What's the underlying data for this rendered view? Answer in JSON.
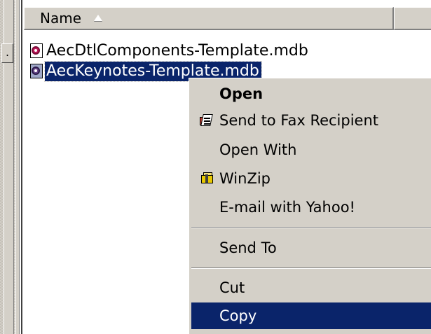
{
  "file_list": {
    "column_header": "Name",
    "files": [
      {
        "name": "AecDtlComponents-Template.mdb",
        "selected": false
      },
      {
        "name": "AecKeynotes-Template.mdb",
        "selected": true
      }
    ]
  },
  "context_menu": {
    "items": [
      {
        "label": "Open",
        "bold": true,
        "icon": ""
      },
      {
        "label": "Send to Fax Recipient",
        "bold": false,
        "icon": "fax-recipient-icon"
      },
      {
        "label": "Open With",
        "bold": false,
        "icon": ""
      },
      {
        "label": "WinZip",
        "bold": false,
        "icon": "winzip-icon"
      },
      {
        "label": "E-mail with Yahoo!",
        "bold": false,
        "icon": ""
      },
      {
        "label": "Send To",
        "bold": false,
        "icon": ""
      },
      {
        "label": "Cut",
        "bold": false,
        "icon": ""
      },
      {
        "label": "Copy",
        "bold": false,
        "icon": "",
        "highlighted": true
      }
    ]
  },
  "colors": {
    "selection": "#0a246a",
    "face": "#d4d0c8",
    "window": "#ffffff"
  }
}
